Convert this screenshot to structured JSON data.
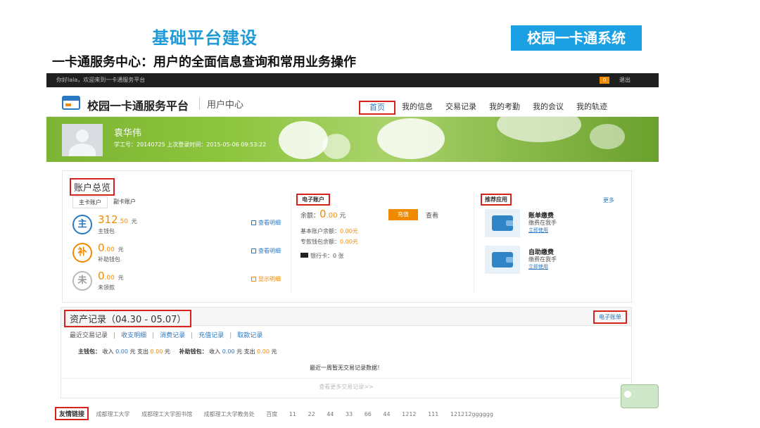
{
  "slide": {
    "title": "基础平台建设",
    "badge": "校园一卡通系统",
    "subtitle": "一卡通服务中心：用户的全面信息查询和常用业务操作"
  },
  "topbar": {
    "welcome": "你好lala，欢迎来到一卡通服务平台",
    "count": "0",
    "logout": "退出"
  },
  "header": {
    "brand": "校园一卡通服务平台",
    "sub": "用户中心",
    "nav": [
      "首页",
      "我的信息",
      "交易记录",
      "我的考勤",
      "我的会议",
      "我的轨迹"
    ]
  },
  "user": {
    "name": "袁华伟",
    "meta": "学工号：20140725   上次登录时间：2015-05-06 09:53:22"
  },
  "account": {
    "title": "账户总览",
    "tabs": [
      "主卡账户",
      "副卡账户"
    ],
    "wallets": [
      {
        "icon": "主",
        "int": "312",
        "dec": ".50",
        "unit": "元",
        "label": "主钱包",
        "link": "查看明细",
        "color": "#2b79c2"
      },
      {
        "icon": "补",
        "int": "0",
        "dec": ".00",
        "unit": "元",
        "label": "补助钱包",
        "link": "查看明细",
        "color": "#f08a00"
      },
      {
        "icon": "未",
        "int": "0",
        "dec": ".00",
        "unit": "元",
        "label": "未领款",
        "link": "显示明细",
        "color": "#999999"
      }
    ]
  },
  "eaccount": {
    "title": "电子账户",
    "balance_label": "余额：",
    "balance_int": "0",
    "balance_dec": ".00",
    "balance_unit": "元",
    "recharge": "充值",
    "view": "查看",
    "basic_label": "基本账户余额：",
    "basic_value": "0.00元",
    "special_label": "专款钱包余额：",
    "special_value": "0.00元",
    "bankcard": "银行卡：0 张"
  },
  "recommend": {
    "title": "推荐应用",
    "more": "更多",
    "apps": [
      {
        "name": "账单缴费",
        "desc": "缴费在我手",
        "link": "立即使用"
      },
      {
        "name": "自助缴费",
        "desc": "缴费在我手",
        "link": "立即使用"
      }
    ]
  },
  "assets": {
    "title": "资产记录（04.30 - 05.07）",
    "ebill": "电子账单",
    "tabs": [
      "最近交易记录",
      "收支明细",
      "消费记录",
      "充值记录",
      "取款记录"
    ],
    "main_label": "主钱包：",
    "sub_label": "补助钱包：",
    "income": "收入",
    "expense": "支出",
    "yuan": "元",
    "zero": "0.00",
    "empty": "最近一周暂无交易记录数据！",
    "more": "查看更多交易记录>>"
  },
  "footer": {
    "title": "友情链接",
    "links": [
      "成都理工大学",
      "成都理工大学图书馆",
      "成都理工大学教务处",
      "百度",
      "11",
      "22",
      "44",
      "33",
      "66",
      "44",
      "1212",
      "111",
      "121212gggggg"
    ]
  },
  "colors": {
    "accent": "#2b79c2",
    "orange": "#f08a00",
    "highlight": "#d8221c",
    "banner": "#8dc53e"
  }
}
